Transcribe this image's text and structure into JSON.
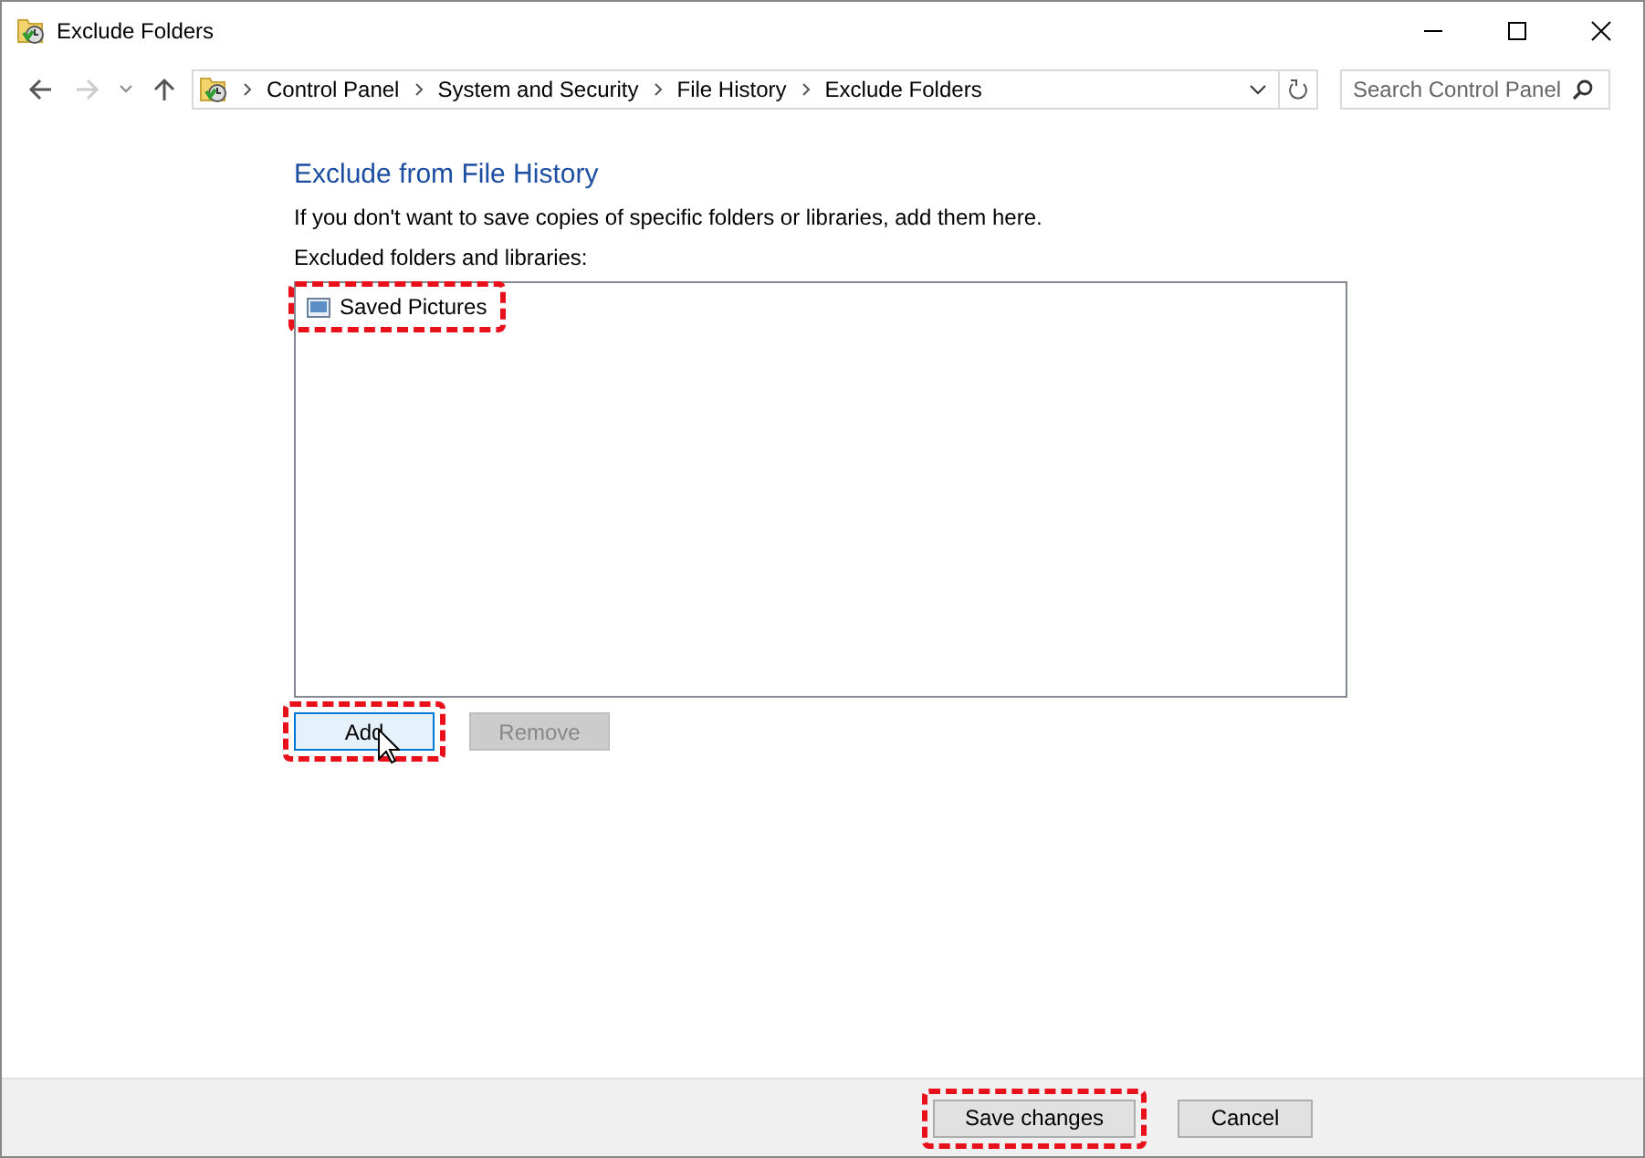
{
  "window": {
    "title": "Exclude Folders"
  },
  "breadcrumb": [
    "Control Panel",
    "System and Security",
    "File History",
    "Exclude Folders"
  ],
  "search": {
    "placeholder": "Search Control Panel"
  },
  "heading": "Exclude from File History",
  "description": "If you don't want to save copies of specific folders or libraries, add them here.",
  "list_label": "Excluded folders and libraries:",
  "list_items": [
    {
      "label": "Saved Pictures",
      "highlighted": true
    }
  ],
  "list_buttons": [
    {
      "label": "Add",
      "disabled": false,
      "focused": true,
      "highlighted": true
    },
    {
      "label": "Remove",
      "disabled": true,
      "focused": false,
      "highlighted": false
    }
  ],
  "footer_buttons": [
    {
      "label": "Save changes",
      "highlighted": true
    },
    {
      "label": "Cancel",
      "highlighted": false
    }
  ]
}
